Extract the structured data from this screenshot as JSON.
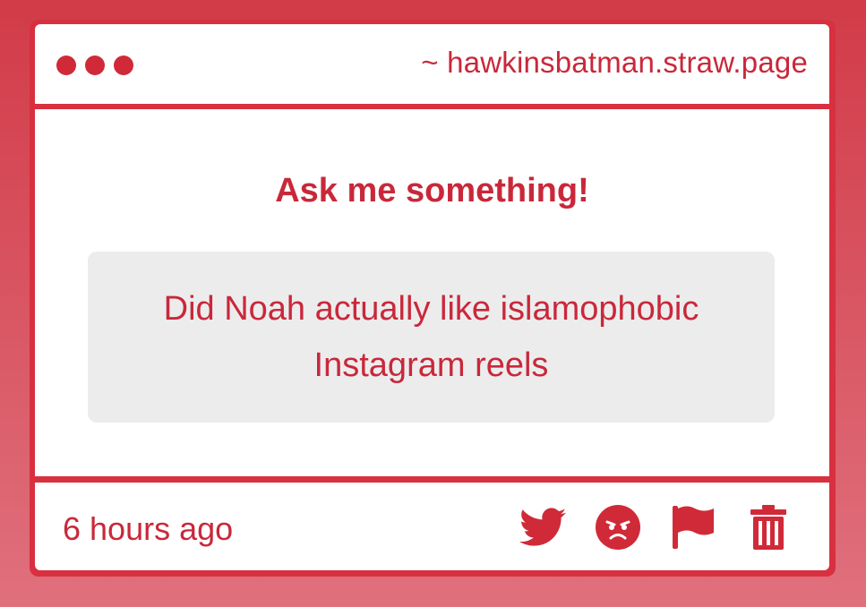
{
  "window": {
    "url": "~ hawkinsbatman.straw.page"
  },
  "main": {
    "heading": "Ask me something!",
    "question": "Did Noah actually like islamophobic Instagram reels"
  },
  "footer": {
    "timestamp": "6 hours ago",
    "actions": [
      {
        "icon": "twitter-icon"
      },
      {
        "icon": "angry-face-icon"
      },
      {
        "icon": "flag-icon"
      },
      {
        "icon": "trash-icon"
      }
    ]
  },
  "colors": {
    "accent": "#d02a38",
    "background_top": "#d23b48",
    "background_bottom": "#e0707d",
    "panel": "#ffffff",
    "question_box": "#ececed"
  }
}
